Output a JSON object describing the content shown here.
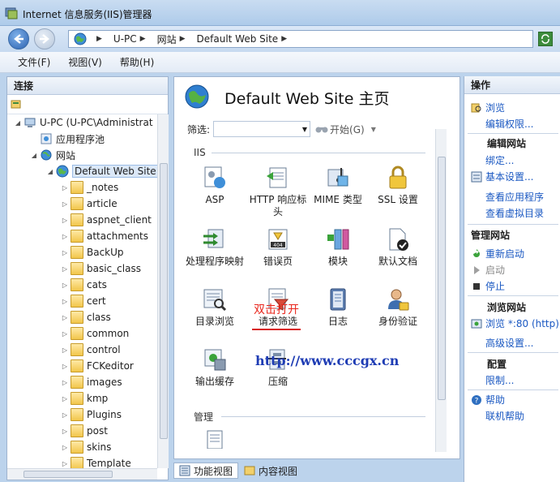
{
  "window": {
    "title": "Internet 信息服务(IIS)管理器"
  },
  "address": {
    "crumbs": [
      "U-PC",
      "网站",
      "Default Web Site"
    ]
  },
  "menu": [
    "文件(F)",
    "视图(V)",
    "帮助(H)"
  ],
  "connections": {
    "header": "连接",
    "tree": [
      {
        "label": "U-PC (U-PC\\Administrat",
        "kind": "server"
      },
      {
        "label": "应用程序池",
        "kind": "pool"
      },
      {
        "label": "网站",
        "kind": "sites"
      },
      {
        "label": "Default Web Site",
        "kind": "site"
      },
      {
        "label": "_notes",
        "kind": "folder"
      },
      {
        "label": "article",
        "kind": "folder"
      },
      {
        "label": "aspnet_client",
        "kind": "folder"
      },
      {
        "label": "attachments",
        "kind": "folder"
      },
      {
        "label": "BackUp",
        "kind": "folder"
      },
      {
        "label": "basic_class",
        "kind": "folder"
      },
      {
        "label": "cats",
        "kind": "folder"
      },
      {
        "label": "cert",
        "kind": "folder"
      },
      {
        "label": "class",
        "kind": "folder"
      },
      {
        "label": "common",
        "kind": "folder"
      },
      {
        "label": "control",
        "kind": "folder"
      },
      {
        "label": "FCKeditor",
        "kind": "folder"
      },
      {
        "label": "images",
        "kind": "folder"
      },
      {
        "label": "kmp",
        "kind": "folder"
      },
      {
        "label": "Plugins",
        "kind": "folder"
      },
      {
        "label": "post",
        "kind": "folder"
      },
      {
        "label": "skins",
        "kind": "folder"
      },
      {
        "label": "Template",
        "kind": "folder"
      }
    ]
  },
  "center": {
    "title": "Default Web Site 主页",
    "filter_label": "筛选:",
    "start_label": "开始(G)",
    "groups": [
      "IIS",
      "管理"
    ],
    "features": [
      {
        "label": "ASP",
        "icon": "asp-icon"
      },
      {
        "label": "HTTP 响应标头",
        "icon": "http-headers-icon"
      },
      {
        "label": "MIME 类型",
        "icon": "mime-icon"
      },
      {
        "label": "SSL 设置",
        "icon": "lock-icon"
      },
      {
        "label": "处理程序映射",
        "icon": "handler-mappings-icon"
      },
      {
        "label": "错误页",
        "icon": "error-pages-icon"
      },
      {
        "label": "模块",
        "icon": "modules-icon"
      },
      {
        "label": "默认文档",
        "icon": "default-document-icon"
      },
      {
        "label": "目录浏览",
        "icon": "directory-browsing-icon"
      },
      {
        "label": "请求筛选",
        "icon": "request-filtering-icon"
      },
      {
        "label": "日志",
        "icon": "logging-icon"
      },
      {
        "label": "身份验证",
        "icon": "authentication-icon"
      },
      {
        "label": "输出缓存",
        "icon": "output-cache-icon"
      },
      {
        "label": "压缩",
        "icon": "compression-icon"
      }
    ],
    "annotation": "双击打开",
    "watermark": "http://www.cccgx.cn"
  },
  "bottom_tabs": [
    "功能视图",
    "内容视图"
  ],
  "actions": {
    "header": "操作",
    "browse": "浏览",
    "edit_permissions": "编辑权限...",
    "edit_site_section": "编辑网站",
    "bindings": "绑定...",
    "basic_settings": "基本设置...",
    "view_apps": "查看应用程序",
    "view_vdirs": "查看虚拟目录",
    "manage_site_section": "管理网站",
    "restart": "重新启动",
    "start": "启动",
    "stop": "停止",
    "browse_site_section": "浏览网站",
    "browse_80": "浏览 *:80 (http)",
    "advanced_settings": "高级设置...",
    "config_section": "配置",
    "limits": "限制...",
    "help": "帮助",
    "online_help": "联机帮助"
  },
  "colors": {
    "link": "#1a58c2",
    "annotation": "#e8241a",
    "watermark": "#1e3cb4"
  }
}
